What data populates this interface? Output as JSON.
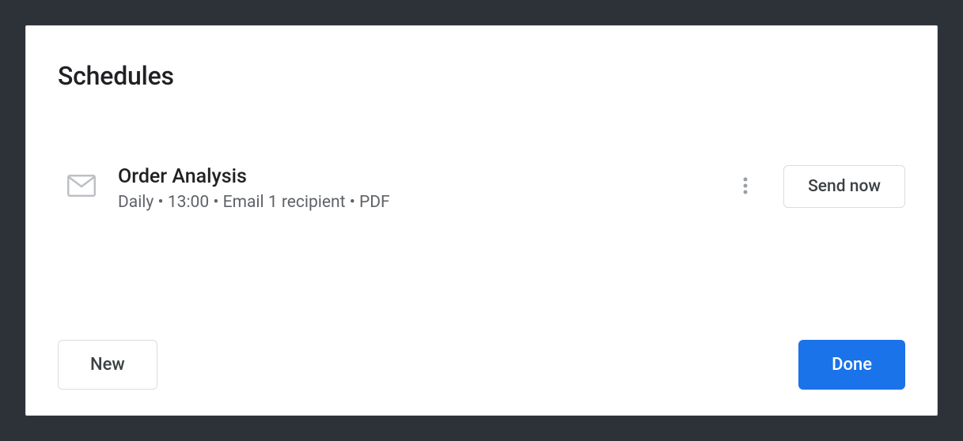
{
  "dialog": {
    "title": "Schedules"
  },
  "schedules": [
    {
      "title": "Order Analysis",
      "subtitle": "Daily • 13:00 • Email 1 recipient • PDF"
    }
  ],
  "buttons": {
    "send_now": "Send now",
    "new": "New",
    "done": "Done"
  }
}
